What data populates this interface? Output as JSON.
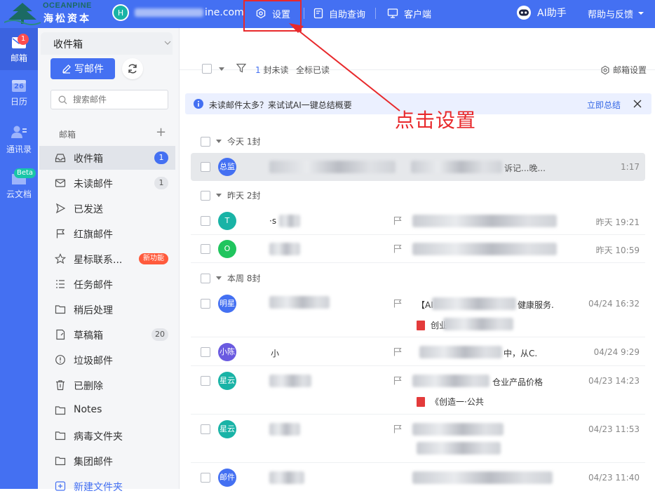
{
  "topbar": {
    "logo_en": "OCEANPINE",
    "logo_cn": "海松资本",
    "avatar_letter": "H",
    "account_email_visible": "ine.com",
    "settings_label": "设置",
    "selfservice_label": "自助查询",
    "client_label": "客户端",
    "ai_label": "AI助手",
    "help_label": "帮助与反馈",
    "colors": {
      "bar": "#4470f2",
      "highlight": "#e8292c"
    }
  },
  "rail": {
    "items": [
      {
        "label": "邮箱",
        "badge": "1",
        "icon": "mail-icon"
      },
      {
        "label": "日历",
        "calendar_day": "26",
        "icon": "calendar-icon"
      },
      {
        "label": "通讯录",
        "icon": "contacts-icon"
      },
      {
        "label": "云文档",
        "badge": "Beta",
        "icon": "cloud-doc-icon"
      }
    ]
  },
  "sidebar": {
    "tab_label": "收件箱",
    "compose_label": "写邮件",
    "search_placeholder": "搜索邮件",
    "mailbox_section": "邮箱",
    "folders": [
      {
        "label": "收件箱",
        "count": "1",
        "icon": "inbox-icon"
      },
      {
        "label": "未读邮件",
        "count": "1",
        "icon": "unread-mail-icon"
      },
      {
        "label": "已发送",
        "icon": "send-icon"
      },
      {
        "label": "红旗邮件",
        "icon": "flag-icon"
      },
      {
        "label": "星标联系...",
        "tag": "新功能",
        "icon": "star-icon"
      },
      {
        "label": "任务邮件",
        "icon": "task-list-icon"
      },
      {
        "label": "稍后处理",
        "icon": "folder-icon"
      },
      {
        "label": "草稿箱",
        "count": "20",
        "icon": "draft-icon"
      },
      {
        "label": "垃圾邮件",
        "icon": "spam-icon"
      },
      {
        "label": "已删除",
        "icon": "trash-icon"
      },
      {
        "label": "Notes",
        "icon": "folder-icon"
      },
      {
        "label": "病毒文件夹",
        "icon": "folder-icon"
      },
      {
        "label": "集团邮件",
        "icon": "folder-icon"
      },
      {
        "label": "新建文件夹",
        "icon": "add-folder-icon"
      }
    ]
  },
  "toolbar": {
    "unread_count_num": "1",
    "unread_count_text": "封未读",
    "mark_all_read": "全标已读",
    "mailbox_settings": "邮箱设置"
  },
  "banner": {
    "text": "未读邮件太多？来试试AI一键总结概要",
    "link": "立即总结"
  },
  "groups": [
    {
      "label": "今天 1封"
    },
    {
      "label": "昨天 2封"
    },
    {
      "label": "本周 8封"
    }
  ],
  "messages": [
    {
      "avatar": "总监",
      "avatar_color": "#4470f2",
      "subject_tail": "诉记...晚...",
      "time": "1:17"
    },
    {
      "avatar": "T",
      "avatar_color": "#19b3a6",
      "sender_frag": "·s",
      "time": "昨天 19:21"
    },
    {
      "avatar": "O",
      "avatar_color": "#20c55e",
      "time": "昨天 10:59"
    },
    {
      "avatar": "明星",
      "avatar_color": "#4470f2",
      "subject_head": "【AI",
      "subject_tail": "健康服务.",
      "attachment": "创业",
      "time": "04/24 16:32"
    },
    {
      "avatar": "小陈",
      "avatar_color": "#6a5ae0",
      "sender_frag": "小",
      "subject_tail": "中，从C.",
      "time": "04/24 9:29"
    },
    {
      "avatar": "星云",
      "avatar_color": "#19b3a6",
      "subject_tail": "仓业产品价格",
      "attachment": "《创造一·公共",
      "time": "04/23 14:23"
    },
    {
      "avatar": "星云",
      "avatar_color": "#19b3a6",
      "time": "04/23 11:53"
    },
    {
      "avatar": "邮件",
      "avatar_color": "#4470f2",
      "time": "04/23 11:40"
    }
  ],
  "annotation": {
    "label": "点击设置"
  }
}
